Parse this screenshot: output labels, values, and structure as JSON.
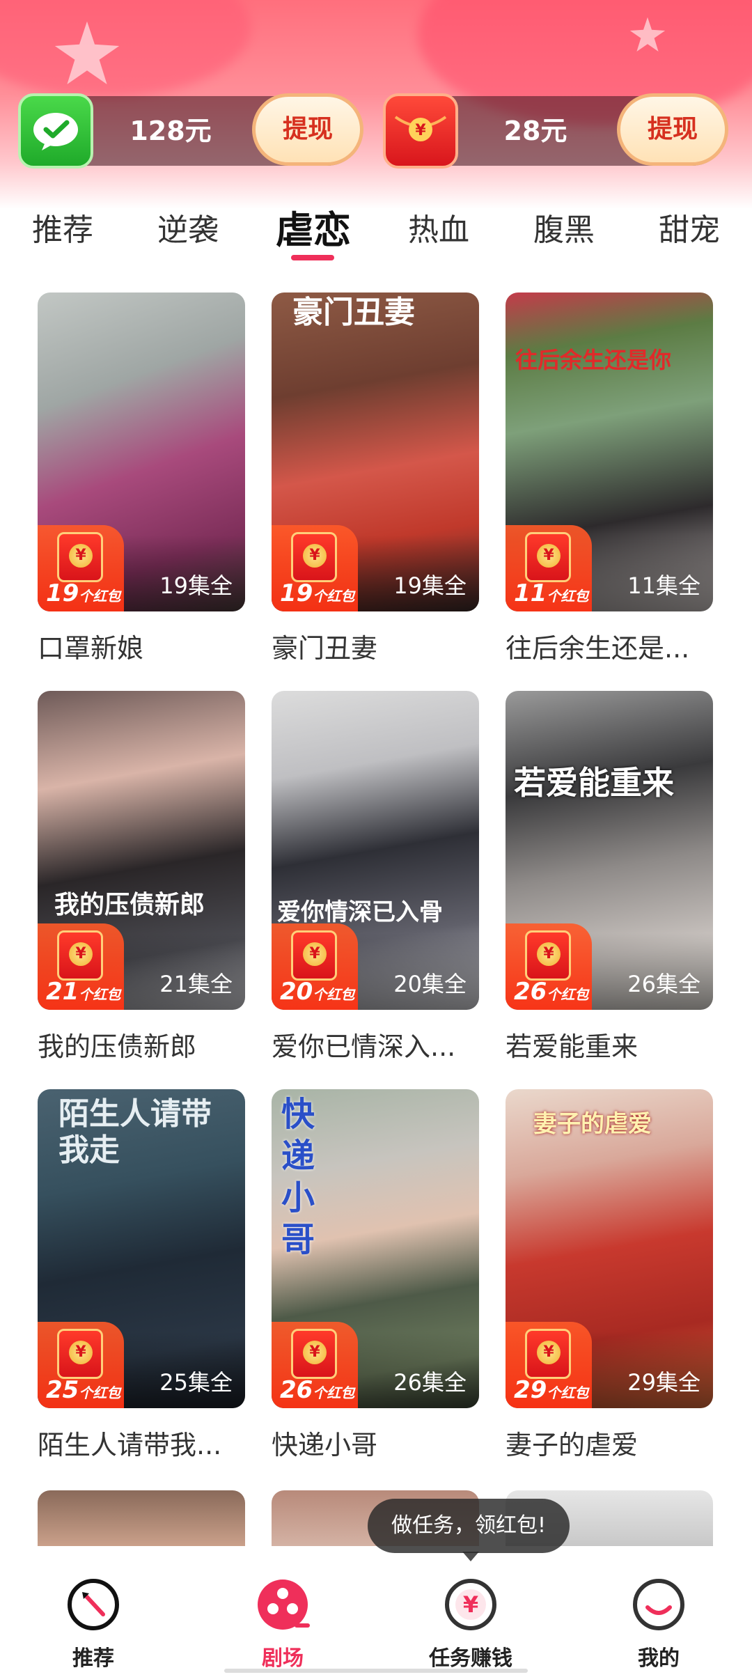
{
  "rewards": [
    {
      "amount": "128元",
      "button": "提现"
    },
    {
      "amount": "28元",
      "button": "提现"
    }
  ],
  "tabs": [
    "推荐",
    "逆袭",
    "虐恋",
    "热血",
    "腹黑",
    "甜宠"
  ],
  "active_tab": "虐恋",
  "dramas": [
    {
      "title": "口罩新娘",
      "episodes": "19集全",
      "redpack_count": "19",
      "redpack_unit": "个红包",
      "overlay": ""
    },
    {
      "title": "豪门丑妻",
      "episodes": "19集全",
      "redpack_count": "19",
      "redpack_unit": "个红包",
      "overlay": "豪门丑妻"
    },
    {
      "title": "往后余生还是...",
      "episodes": "11集全",
      "redpack_count": "11",
      "redpack_unit": "个红包",
      "overlay": "往后余生还是你"
    },
    {
      "title": "我的压债新郎",
      "episodes": "21集全",
      "redpack_count": "21",
      "redpack_unit": "个红包",
      "overlay": "我的压债新郎"
    },
    {
      "title": "爱你已情深入...",
      "episodes": "20集全",
      "redpack_count": "20",
      "redpack_unit": "个红包",
      "overlay": "爱你情深已入骨"
    },
    {
      "title": "若爱能重来",
      "episodes": "26集全",
      "redpack_count": "26",
      "redpack_unit": "个红包",
      "overlay": "若爱能重来"
    },
    {
      "title": "陌生人请带我...",
      "episodes": "25集全",
      "redpack_count": "25",
      "redpack_unit": "个红包",
      "overlay": "陌生人请带我走"
    },
    {
      "title": "快递小哥",
      "episodes": "26集全",
      "redpack_count": "26",
      "redpack_unit": "个红包",
      "overlay": "快递小哥"
    },
    {
      "title": "妻子的虐爱",
      "episodes": "29集全",
      "redpack_count": "29",
      "redpack_unit": "个红包",
      "overlay": "妻子的虐爱"
    }
  ],
  "tooltip": "做任务，领红包!",
  "nav": [
    {
      "label": "推荐",
      "icon": "compass-icon"
    },
    {
      "label": "剧场",
      "icon": "film-reel-icon"
    },
    {
      "label": "任务赚钱",
      "icon": "yuan-coin-icon"
    },
    {
      "label": "我的",
      "icon": "smile-profile-icon"
    }
  ],
  "active_nav": "剧场",
  "colors": {
    "accent": "#ef2f5a",
    "brand_red": "#ff4a3a",
    "wechat_green": "#2ec13a"
  }
}
